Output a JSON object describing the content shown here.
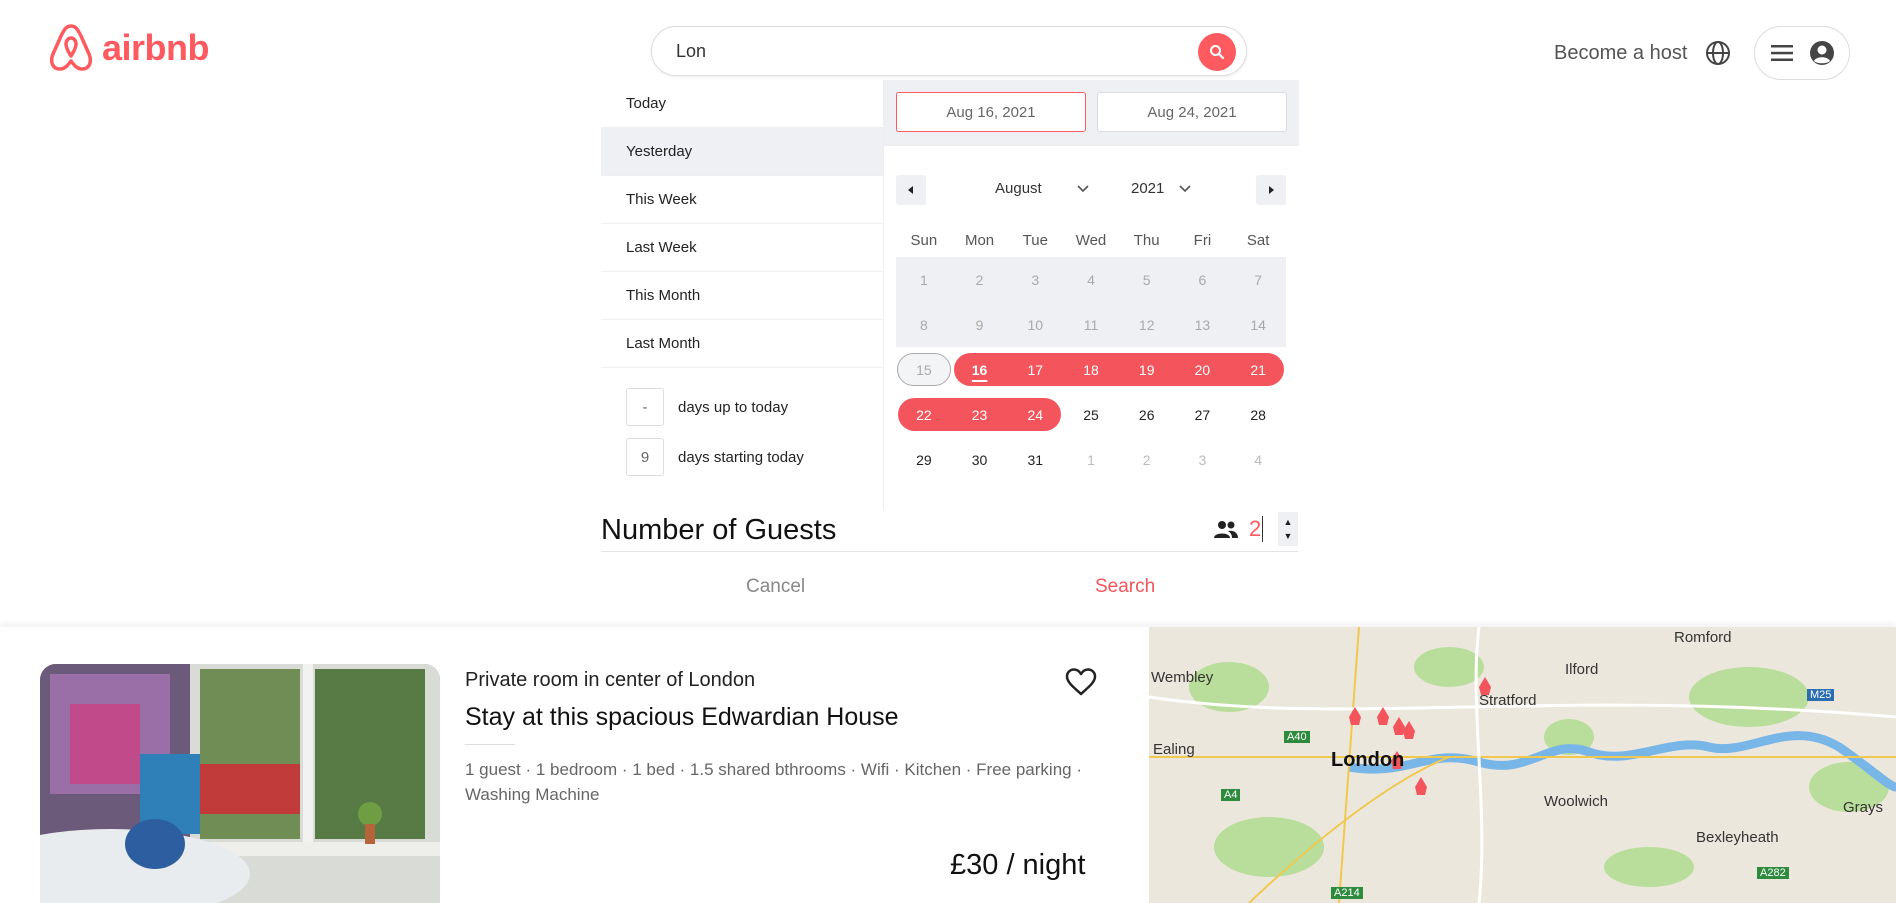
{
  "header": {
    "logo_text": "airbnb",
    "search_value": "Lon",
    "become_host": "Become a host"
  },
  "presets": [
    "Today",
    "Yesterday",
    "This Week",
    "Last Week",
    "This Month",
    "Last Month"
  ],
  "day_ranges": [
    {
      "value": "-",
      "label": "days up to today"
    },
    {
      "value": "9",
      "label": "days starting today"
    }
  ],
  "calendar": {
    "start_date": "Aug 16, 2021",
    "end_date": "Aug 24, 2021",
    "month": "August",
    "year": "2021",
    "weekdays": [
      "Sun",
      "Mon",
      "Tue",
      "Wed",
      "Thu",
      "Fri",
      "Sat"
    ],
    "days": [
      {
        "n": "1",
        "s": "past"
      },
      {
        "n": "2",
        "s": "past"
      },
      {
        "n": "3",
        "s": "past"
      },
      {
        "n": "4",
        "s": "past"
      },
      {
        "n": "5",
        "s": "past"
      },
      {
        "n": "6",
        "s": "past"
      },
      {
        "n": "7",
        "s": "past"
      },
      {
        "n": "8",
        "s": "past"
      },
      {
        "n": "9",
        "s": "past"
      },
      {
        "n": "10",
        "s": "past"
      },
      {
        "n": "11",
        "s": "past"
      },
      {
        "n": "12",
        "s": "past"
      },
      {
        "n": "13",
        "s": "past"
      },
      {
        "n": "14",
        "s": "past"
      },
      {
        "n": "15",
        "s": "today-past"
      },
      {
        "n": "16",
        "s": "inr rs start"
      },
      {
        "n": "17",
        "s": "inr"
      },
      {
        "n": "18",
        "s": "inr"
      },
      {
        "n": "19",
        "s": "inr"
      },
      {
        "n": "20",
        "s": "inr"
      },
      {
        "n": "21",
        "s": "inr re"
      },
      {
        "n": "22",
        "s": "inr rs"
      },
      {
        "n": "23",
        "s": "inr"
      },
      {
        "n": "24",
        "s": "inr re"
      },
      {
        "n": "25",
        "s": ""
      },
      {
        "n": "26",
        "s": ""
      },
      {
        "n": "27",
        "s": ""
      },
      {
        "n": "28",
        "s": ""
      },
      {
        "n": "29",
        "s": ""
      },
      {
        "n": "30",
        "s": ""
      },
      {
        "n": "31",
        "s": ""
      },
      {
        "n": "1",
        "s": "other"
      },
      {
        "n": "2",
        "s": "other"
      },
      {
        "n": "3",
        "s": "other"
      },
      {
        "n": "4",
        "s": "other"
      }
    ]
  },
  "guests": {
    "label": "Number of Guests",
    "value": "2"
  },
  "actions": {
    "cancel": "Cancel",
    "search": "Search"
  },
  "listing": {
    "subtitle": "Private room in center of London",
    "title": "Stay at this spacious Edwardian House",
    "features": "1 guest · 1 bedroom · 1 bed · 1.5 shared bthrooms · Wifi · Kitchen · Free parking · Washing Machine",
    "price": "£30 / night"
  },
  "map": {
    "labels": [
      "Romford",
      "Wembley",
      "Ilford",
      "Stratford",
      "M25",
      "A40",
      "London",
      "Ealing",
      "A4",
      "Woolwich",
      "Grays",
      "Bexleyheath",
      "A282",
      "A214"
    ]
  },
  "colors": {
    "brand": "#FF5A5F",
    "range": "#F4545B"
  }
}
